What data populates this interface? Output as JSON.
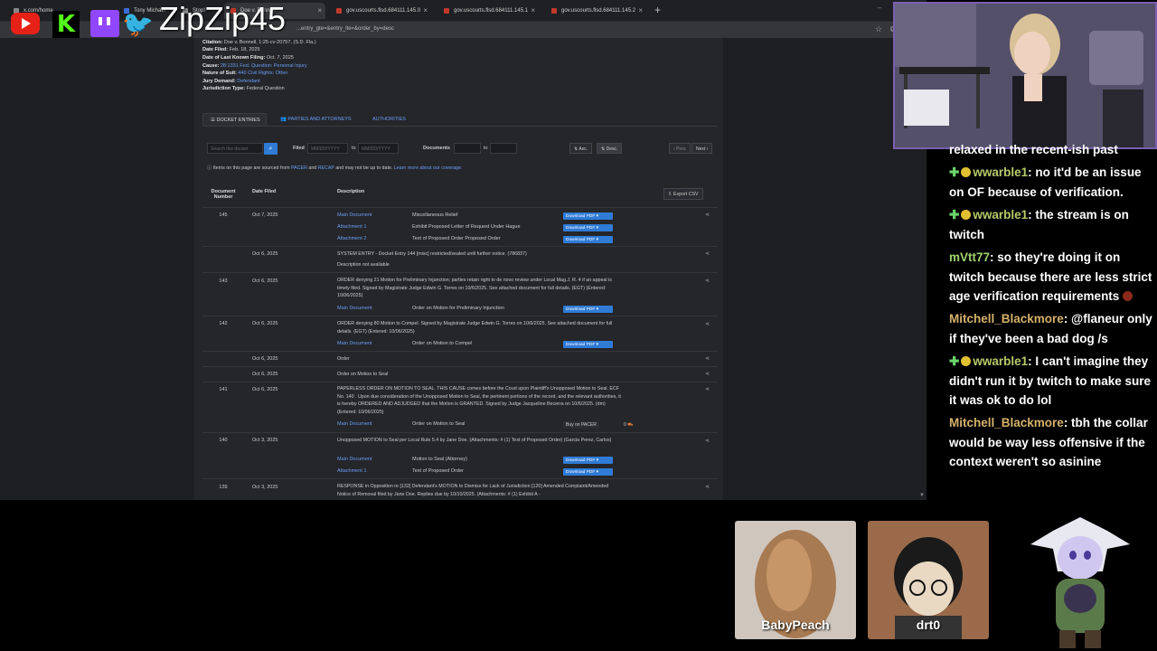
{
  "stream": {
    "name": "ZipZip45",
    "camera_alt": "streamer webcam"
  },
  "browser": {
    "tabs": [
      {
        "label": "x.com/home"
      },
      {
        "label": "Tony Michael"
      },
      {
        "label": "Stop!"
      },
      {
        "label": "Doe v. Bonnell"
      },
      {
        "label": "gov.uscourts.flsd.684111.145.0"
      },
      {
        "label": "gov.uscourts.flsd.684111.145.1"
      },
      {
        "label": "gov.uscourts.flsd.684111.145.2"
      }
    ],
    "url": "...entry_gte=&entry_lte=&order_by=desc",
    "url_left": "rtlist..."
  },
  "case": {
    "citation_label": "Citation:",
    "citation": "Doe v. Bonnell, 1:25-cv-20757, (S.D. Fla.)",
    "filed_label": "Date Filed:",
    "filed": "Feb. 18, 2025",
    "last_filing_label": "Date of Last Known Filing:",
    "last_filing": "Oct. 7, 2025",
    "cause_label": "Cause:",
    "cause": "28:1331 Fed. Question: Personal Injury",
    "nature_label": "Nature of Suit:",
    "nature": "440 Civil Rights: Other",
    "jury_label": "Jury Demand:",
    "jury": "Defendant",
    "jurisdiction_label": "Jurisdiction Type:",
    "jurisdiction": "Federal Question"
  },
  "doc_tabs": {
    "entries": "DOCKET ENTRIES",
    "parties": "PARTIES AND ATTORNEYS",
    "authorities": "AUTHORITIES"
  },
  "filters": {
    "search_placeholder": "Search this docket",
    "filed_label": "Filed",
    "date_from_placeholder": "MM/DD/YYYY",
    "to_label": "to",
    "date_to_placeholder": "MM/DD/YYYY",
    "documents_label": "Documents",
    "to_label2": "to",
    "asc": "Asc.",
    "desc": "Desc.",
    "prev": "‹ Prev.",
    "next": "Next ›"
  },
  "notice": {
    "pre": "Items on this page are sourced from ",
    "pacer": "PACER",
    "and": " and ",
    "recap": "RECAP",
    "mid": " and may not be up to date. ",
    "learn": "Learn more about our coverage."
  },
  "table": {
    "col_number": "Document Number",
    "col_date": "Date Filed",
    "col_desc": "Description",
    "export": "Export CSV",
    "download": "Download PDF",
    "buy": "Buy on PACER",
    "buy_price": "0",
    "rows": {
      "r145": {
        "num": "145",
        "date": "Oct 7, 2025",
        "a1": "Main Document",
        "d1": "Miscellaneous Relief",
        "a2": "Attachment 1",
        "d2": "Exhibit Proposed Letter of Request Under Hague",
        "a3": "Attachment 2",
        "d3": "Text of Proposed Order Proposed Order"
      },
      "rsys": {
        "date": "Oct 6, 2025",
        "desc": "SYSTEM ENTRY - Docket Entry 144 [misc] restricted/sealed until further notice. (786837)",
        "sub": "Description not available"
      },
      "r143": {
        "num": "143",
        "date": "Oct 6, 2025",
        "desc": "ORDER denying 21 Motion for Preliminary Injunction; parties retain right to de novo review under Local Mag.J. R. 4 if an appeal is timely filed. Signed by Magistrate Judge Edwin G. Torres on 10/6/2025. See attached document for full details. (EGT) (Entered: 10/06/2025)",
        "a1": "Main Document",
        "d1": "Order on Motion for Preliminary Injunction"
      },
      "r142": {
        "num": "142",
        "date": "Oct 6, 2025",
        "desc": "ORDER denying 80 Motion to Compel. Signed by Magistrate Judge Edwin G. Torres on 10/6/2025. See attached document for full details. (EGT) (Entered: 10/06/2025)",
        "a1": "Main Document",
        "d1": "Order on Motion to Compel"
      },
      "rord": {
        "date": "Oct 6, 2025",
        "desc": "Order"
      },
      "rseal": {
        "date": "Oct 6, 2025",
        "desc": "Order on Motion to Seal"
      },
      "r141": {
        "num": "141",
        "date": "Oct 6, 2025",
        "desc": "PAPERLESS ORDER ON MOTION TO SEAL. THIS CAUSE comes before the Court upon Plaintiff's Unopposed Motion to Seal. ECF No. 140 . Upon due consideration of the Unopposed Motion to Seal, the pertinent portions of the record, and the relevant authorities, it is hereby ORDERED AND ADJUDGED that the Motion is GRANTED. Signed by Judge Jacqueline Becerra on 10/6/2025. (dm) (Entered: 10/06/2025)",
        "a1": "Main Document",
        "d1": "Order on Motion to Seal"
      },
      "r140": {
        "num": "140",
        "date": "Oct 3, 2025",
        "desc": "Unopposed MOTION to Seal per Local Rule 5.4 by Jane Doe. (Attachments: # (1) Text of Proposed Order) (Garcia Perez, Carlos)",
        "a1": "Main Document",
        "d1": "Motion to Seal (Attorney)",
        "a2": "Attachment 1",
        "d2": "Text of Proposed Order"
      },
      "r139": {
        "num": "139",
        "date": "Oct 3, 2025",
        "desc": "RESPONSE in Opposition re [132] Defendant's MOTION to Dismiss for Lack of Jurisdiction [120] Amended Complaint/Amended Notice of Removal filed by Jane Doe. Replies due by 10/10/2025. (Attachments: # (1) Exhibit A -"
      }
    }
  },
  "chat": {
    "m0": {
      "text": "relaxed in the recent-ish past"
    },
    "m1": {
      "user": "wwarble1",
      "text": ": no it'd be an issue on OF because of verification."
    },
    "m2": {
      "user": "wwarble1",
      "text": ": the stream is on twitch"
    },
    "m3": {
      "user": "mVtt77",
      "text": ": so they're doing it on twitch because there are less strict age verification requirements"
    },
    "m4": {
      "user": "Mitchell_Blackmore",
      "text": ": @flaneur only if they've been a bad dog /s"
    },
    "m5": {
      "user": "wwarble1",
      "text": ": I can't imagine they didn't run it by twitch to make sure it was ok to do lol"
    },
    "m6": {
      "user": "Mitchell_Blackmore",
      "text": ": tbh the collar would be way less offensive if the context weren't so asinine"
    }
  },
  "avatars": {
    "a1": "BabyPeach",
    "a2": "drt0"
  }
}
